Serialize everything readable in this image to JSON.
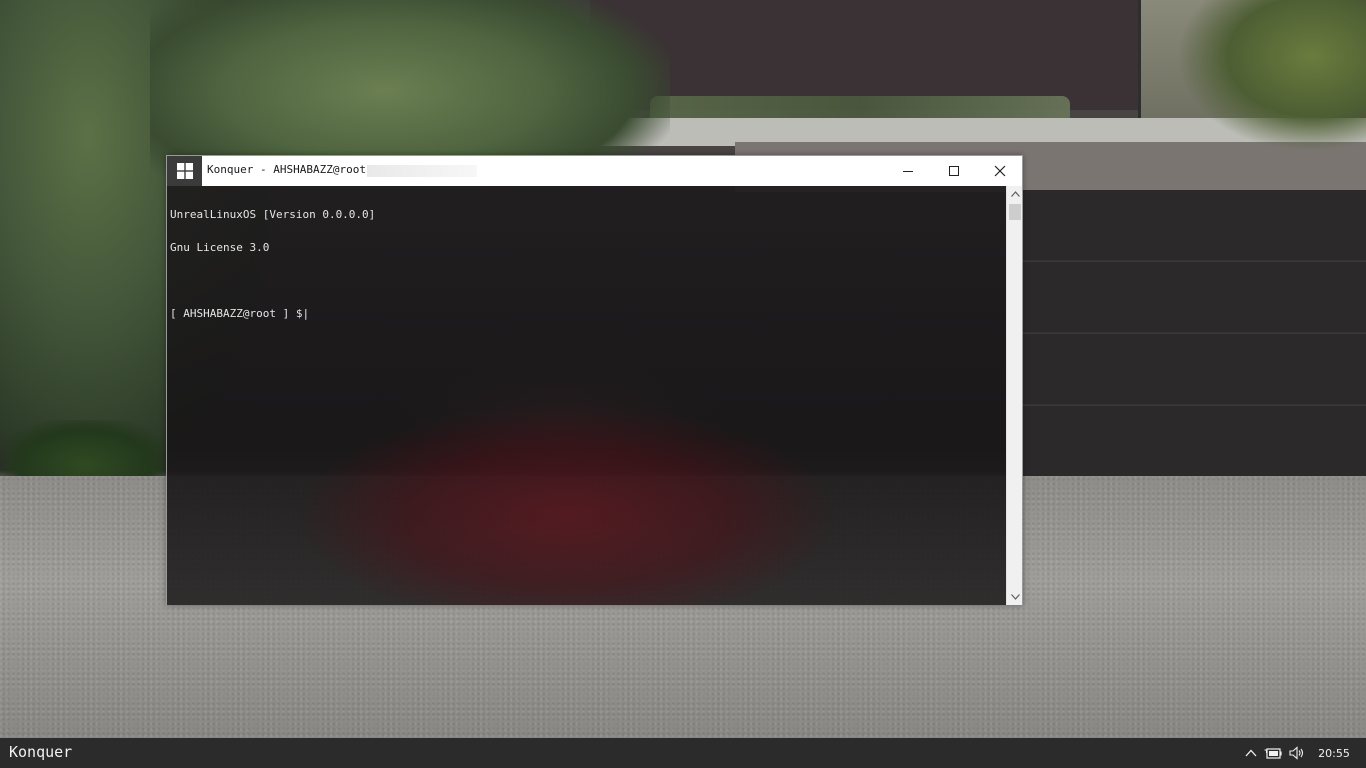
{
  "window": {
    "title": "Konquer - AHSHABAZZ@root",
    "logo_icon": "windows-logo-icon",
    "minimize_icon": "minimize-icon",
    "maximize_icon": "maximize-icon",
    "close_icon": "close-icon"
  },
  "console": {
    "lines": [
      "UnrealLinuxOS [Version 0.0.0.0]",
      "Gnu License 3.0"
    ],
    "prompt": "[ AHSHABAZZ@root ] $|"
  },
  "scrollbar": {
    "up_icon": "chevron-up-icon",
    "down_icon": "chevron-down-icon"
  },
  "taskbar": {
    "app_label": "Konquer",
    "clock": "20:55",
    "tray_icons": [
      "chevron-up-icon",
      "battery-icon",
      "volume-icon"
    ]
  },
  "colors": {
    "taskbar_bg": "#2b2b2b",
    "titlebar_bg": "#ffffff",
    "console_text": "#e6e6e6",
    "logo_tile_bg": "#3b3b3b"
  }
}
